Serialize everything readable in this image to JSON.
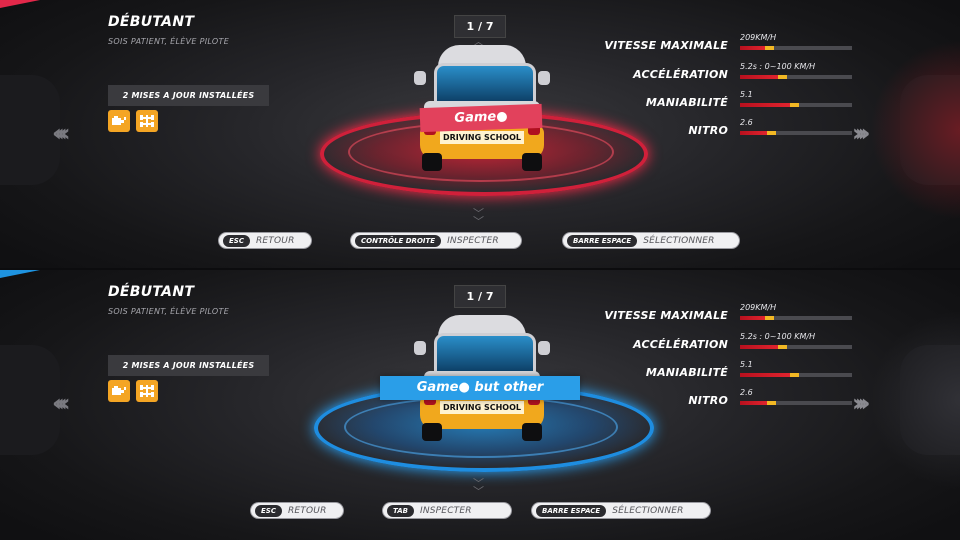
{
  "top": {
    "title": "DÉBUTANT",
    "subtitle": "SOIS PATIENT, ÉLÈVE PILOTE",
    "upgrades_label": "2 MISES A JOUR INSTALLÉES",
    "counter": "1 / 7",
    "plate": "DRIVING SCHOOL",
    "car_name": "Game●",
    "stats": [
      {
        "label": "VITESSE MAXIMALE",
        "value": "209KM/H",
        "fill": 0.22
      },
      {
        "label": "ACCÉLÉRATION",
        "value": "5.2s : 0~100 KM/H",
        "fill": 0.34
      },
      {
        "label": "MANIABILITÉ",
        "value": "5.1",
        "fill": 0.45
      },
      {
        "label": "NITRO",
        "value": "2.6",
        "fill": 0.24
      }
    ],
    "buttons": [
      {
        "key": "ESC",
        "action": "RETOUR"
      },
      {
        "key": "CONTRÔLE DROITE",
        "action": "INSPECTER"
      },
      {
        "key": "BARRE ESPACE",
        "action": "SÉLECTIONNER"
      }
    ],
    "accent": "#e3284a"
  },
  "bottom": {
    "title": "DÉBUTANT",
    "subtitle": "SOIS PATIENT, ÉLÈVE PILOTE",
    "upgrades_label": "2 MISES A JOUR INSTALLÉES",
    "counter": "1 / 7",
    "plate": "DRIVING SCHOOL",
    "car_name": "Game● but other",
    "stats": [
      {
        "label": "VITESSE MAXIMALE",
        "value": "209KM/H",
        "fill": 0.22
      },
      {
        "label": "ACCÉLÉRATION",
        "value": "5.2s : 0~100 KM/H",
        "fill": 0.34
      },
      {
        "label": "MANIABILITÉ",
        "value": "5.1",
        "fill": 0.45
      },
      {
        "label": "NITRO",
        "value": "2.6",
        "fill": 0.24
      }
    ],
    "buttons": [
      {
        "key": "ESC",
        "action": "RETOUR"
      },
      {
        "key": "TAB",
        "action": "INSPECTER"
      },
      {
        "key": "BARRE ESPACE",
        "action": "SÉLECTIONNER"
      }
    ],
    "accent": "#1e93e0"
  },
  "icons": [
    "engine-upgrade-icon",
    "chassis-upgrade-icon",
    "chevron-left-icon",
    "chevron-right-icon",
    "chevron-up-icon",
    "chevron-down-icon"
  ]
}
